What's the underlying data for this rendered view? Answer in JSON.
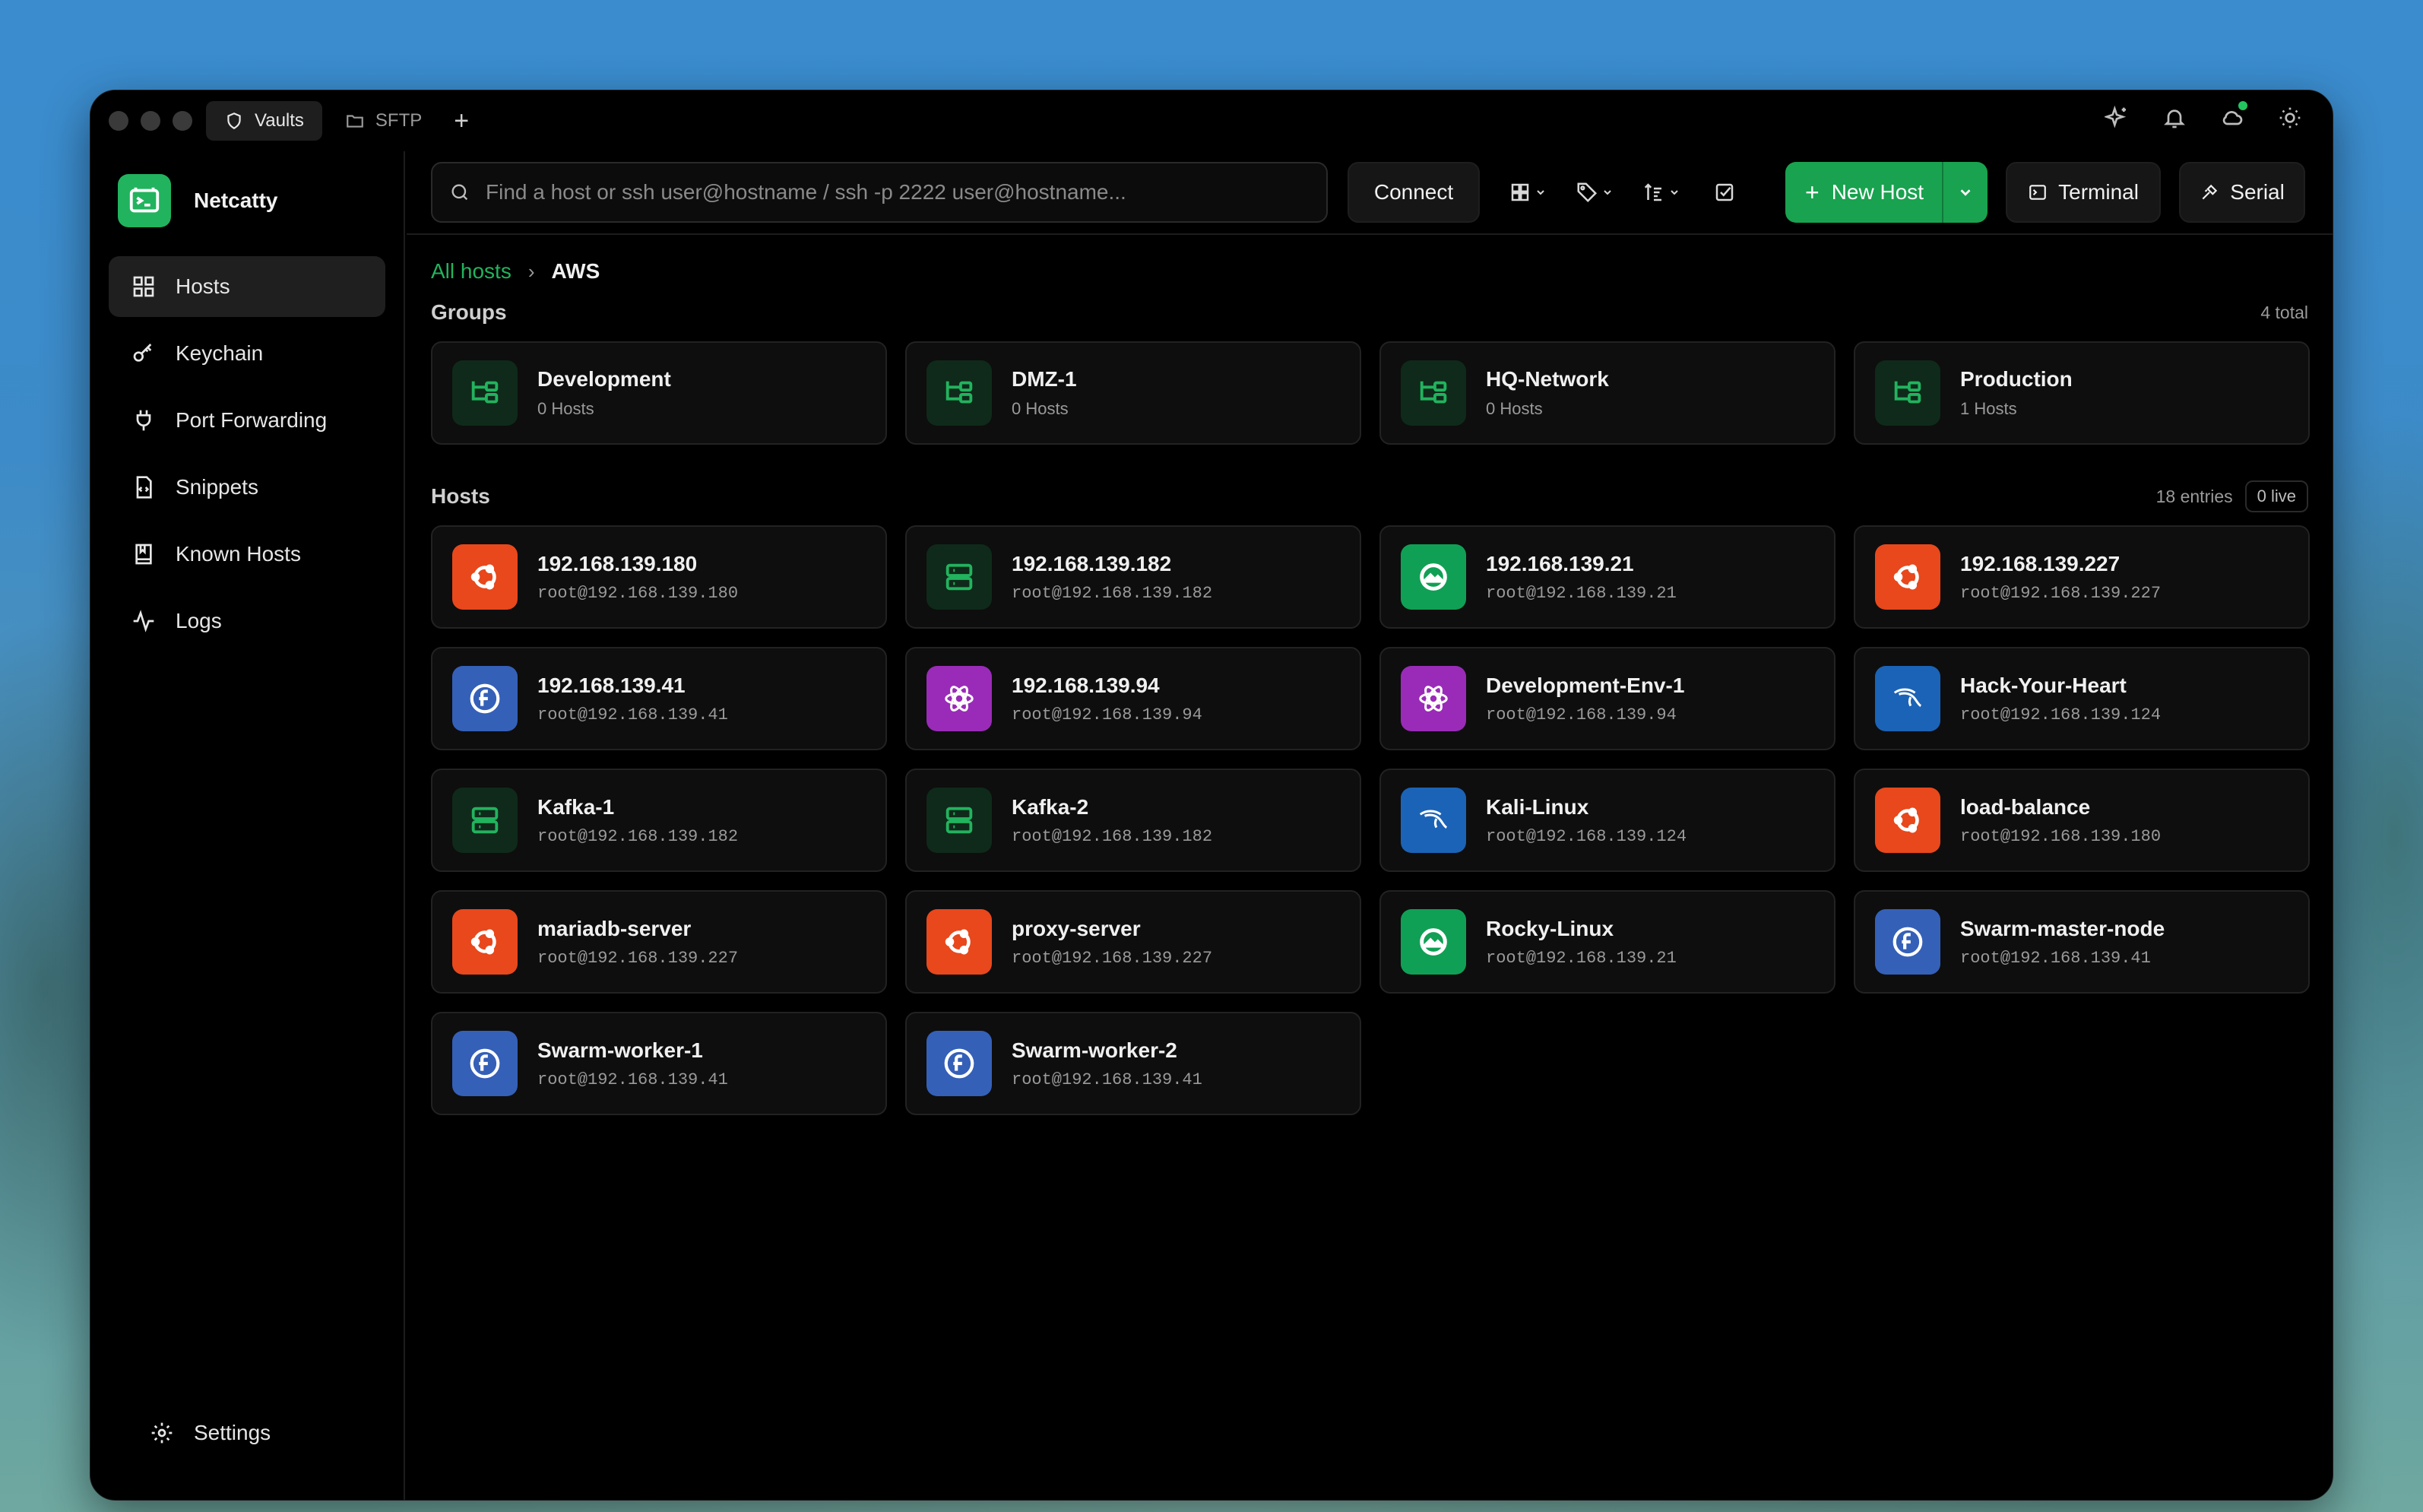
{
  "titlebar": {
    "tabs": [
      {
        "label": "Vaults",
        "icon": "shield-icon",
        "active": true
      },
      {
        "label": "SFTP",
        "icon": "folder-icon",
        "active": false
      }
    ],
    "add_tab": "+"
  },
  "sidebar": {
    "brand": "Netcatty",
    "items": [
      {
        "label": "Hosts",
        "icon": "grid-icon",
        "active": true
      },
      {
        "label": "Keychain",
        "icon": "key-icon"
      },
      {
        "label": "Port Forwarding",
        "icon": "plug-icon"
      },
      {
        "label": "Snippets",
        "icon": "snippet-file-icon"
      },
      {
        "label": "Known Hosts",
        "icon": "bookmark-book-icon"
      },
      {
        "label": "Logs",
        "icon": "activity-icon"
      }
    ],
    "settings": "Settings"
  },
  "toolbar": {
    "search_placeholder": "Find a host or ssh user@hostname / ssh -p 2222 user@hostname...",
    "connect": "Connect",
    "new_host": "New Host",
    "terminal": "Terminal",
    "serial": "Serial"
  },
  "breadcrumb": {
    "root": "All hosts",
    "separator": "›",
    "current": "AWS"
  },
  "groups": {
    "title": "Groups",
    "count": "4 total",
    "items": [
      {
        "name": "Development",
        "hosts": "0 Hosts"
      },
      {
        "name": "DMZ-1",
        "hosts": "0 Hosts"
      },
      {
        "name": "HQ-Network",
        "hosts": "0 Hosts"
      },
      {
        "name": "Production",
        "hosts": "1 Hosts"
      }
    ]
  },
  "hosts": {
    "title": "Hosts",
    "count": "18 entries",
    "live": "0 live",
    "items": [
      {
        "name": "192.168.139.180",
        "addr": "root@192.168.139.180",
        "os": "ubuntu"
      },
      {
        "name": "192.168.139.182",
        "addr": "root@192.168.139.182",
        "os": "server"
      },
      {
        "name": "192.168.139.21",
        "addr": "root@192.168.139.21",
        "os": "rocky"
      },
      {
        "name": "192.168.139.227",
        "addr": "root@192.168.139.227",
        "os": "ubuntu"
      },
      {
        "name": "192.168.139.41",
        "addr": "root@192.168.139.41",
        "os": "fedora"
      },
      {
        "name": "192.168.139.94",
        "addr": "root@192.168.139.94",
        "os": "redox"
      },
      {
        "name": "Development-Env-1",
        "addr": "root@192.168.139.94",
        "os": "redox"
      },
      {
        "name": "Hack-Your-Heart",
        "addr": "root@192.168.139.124",
        "os": "kali"
      },
      {
        "name": "Kafka-1",
        "addr": "root@192.168.139.182",
        "os": "server"
      },
      {
        "name": "Kafka-2",
        "addr": "root@192.168.139.182",
        "os": "server"
      },
      {
        "name": "Kali-Linux",
        "addr": "root@192.168.139.124",
        "os": "kali"
      },
      {
        "name": "load-balance",
        "addr": "root@192.168.139.180",
        "os": "ubuntu"
      },
      {
        "name": "mariadb-server",
        "addr": "root@192.168.139.227",
        "os": "ubuntu"
      },
      {
        "name": "proxy-server",
        "addr": "root@192.168.139.227",
        "os": "ubuntu"
      },
      {
        "name": "Rocky-Linux",
        "addr": "root@192.168.139.21",
        "os": "rocky"
      },
      {
        "name": "Swarm-master-node",
        "addr": "root@192.168.139.41",
        "os": "fedora"
      },
      {
        "name": "Swarm-worker-1",
        "addr": "root@192.168.139.41",
        "os": "fedora"
      },
      {
        "name": "Swarm-worker-2",
        "addr": "root@192.168.139.41",
        "os": "fedora"
      }
    ]
  },
  "colors": {
    "accent": "#19a24f",
    "ubuntu": "#e8481c",
    "server": "#0f2a1a",
    "rocky": "#10a055",
    "fedora": "#3560b8",
    "redox": "#9a2bb8",
    "kali": "#1b63b6"
  }
}
